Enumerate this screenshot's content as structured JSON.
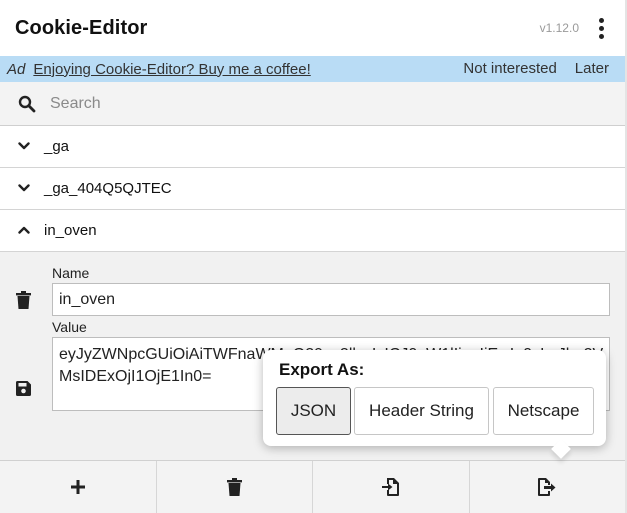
{
  "header": {
    "title": "Cookie-Editor",
    "version": "v1.12.0"
  },
  "ad": {
    "tag": "Ad",
    "link_text": "Enjoying Cookie-Editor? Buy me a coffee!",
    "not_interested": "Not interested",
    "later": "Later",
    "background": "#b9dcf5"
  },
  "search": {
    "placeholder": "Search",
    "value": ""
  },
  "cookies": [
    {
      "name": "_ga",
      "expanded": false
    },
    {
      "name": "_ga_404Q5QJTEC",
      "expanded": false
    },
    {
      "name": "in_oven",
      "expanded": true
    }
  ],
  "details": {
    "name_label": "Name",
    "name_value": "in_oven",
    "value_label": "Value",
    "value_line1": "eyJyZWNpcGUiOiAiTWFnaWMgQ29va2llcyIsICJ0aW1lIjogIjEwIn0sImJha2Vk",
    "value_line2": "MsIDExOjI1OjE1In0="
  },
  "toolbar": {
    "items": [
      {
        "icon": "plus-icon"
      },
      {
        "icon": "trash-icon"
      },
      {
        "icon": "import-icon"
      },
      {
        "icon": "export-icon"
      }
    ]
  },
  "export_popover": {
    "title": "Export As:",
    "options": [
      "JSON",
      "Header String",
      "Netscape"
    ],
    "selected": "JSON"
  }
}
